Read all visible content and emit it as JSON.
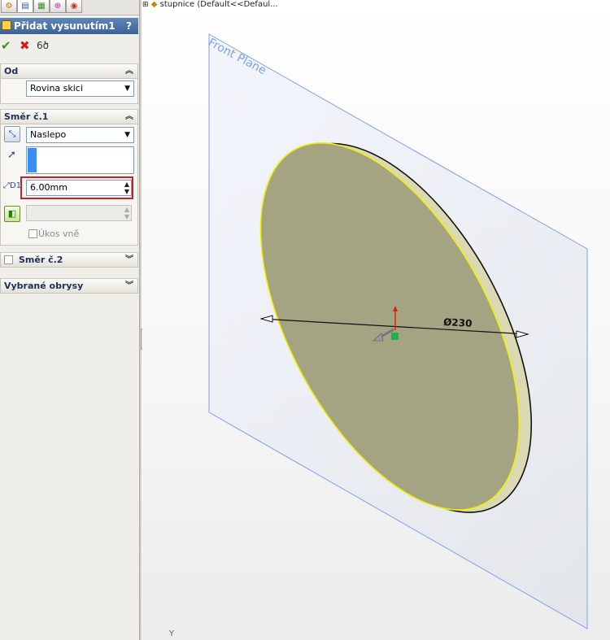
{
  "property_manager": {
    "title": "Přidat vysunutím1",
    "help": "?",
    "tabs": [
      "feature-manager",
      "property-manager",
      "configuration-manager",
      "dimxpert-manager",
      "display-manager"
    ]
  },
  "groups": {
    "from": {
      "title": "Od",
      "combo_value": "Rovina skici"
    },
    "direction1": {
      "title": "Směr č.1",
      "end_condition": "Naslepo",
      "depth": "6.00mm",
      "draft_label": "Úkos vně"
    },
    "direction2": {
      "title": "Směr č.2"
    },
    "selected_contours": {
      "title": "Vybrané obrysy"
    }
  },
  "viewport": {
    "tree_item": "stupnice  (Default<<Defaul...",
    "plane_label": "Front Plane",
    "dimension_label": "Ø230",
    "axis_label": "Y",
    "colors": {
      "plane_edge": "#7da1e8",
      "disc_face": "#a4a382",
      "disc_rim": "#dad9b4",
      "edge_highlight": "#f2f000"
    }
  }
}
